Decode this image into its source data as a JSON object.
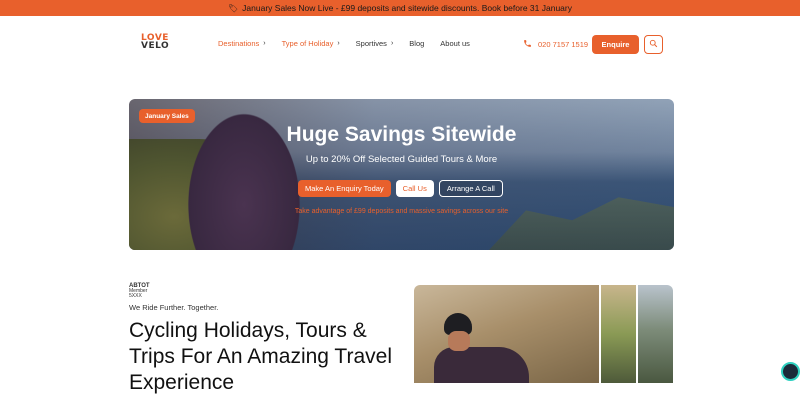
{
  "promo": {
    "icon": "tag-icon",
    "text": "January Sales Now Live - £99 deposits and sitewide discounts. Book before 31 January"
  },
  "logo": {
    "line1": "LOVE",
    "line2": "VELO"
  },
  "nav": {
    "items": [
      {
        "label": "Destinations",
        "has_chevron": true,
        "active": true
      },
      {
        "label": "Type of Holiday",
        "has_chevron": true,
        "active": true
      },
      {
        "label": "Sportives",
        "has_chevron": true,
        "active": false
      },
      {
        "label": "Blog",
        "has_chevron": false,
        "active": false
      },
      {
        "label": "About us",
        "has_chevron": false,
        "active": false
      }
    ],
    "chevron": "›"
  },
  "contact": {
    "phone": "020 7157 1519",
    "icon": "phone-icon"
  },
  "header": {
    "enquire_label": "Enquire",
    "search_icon": "search-icon"
  },
  "hero": {
    "badge": "January Sales",
    "title": "Huge Savings Sitewide",
    "subtitle": "Up to 20% Off Selected Guided Tours & More",
    "buttons": {
      "enquiry": "Make An Enquiry Today",
      "call": "Call Us",
      "arrange": "Arrange A Call"
    },
    "note": "Take advantage of £99 deposits and massive savings across our site"
  },
  "abtot": {
    "title": "ABTOT",
    "sub1": "Member",
    "sub2": "5XXX"
  },
  "intro": {
    "tagline": "We Ride Further. Together.",
    "headline": "Cycling Holidays, Tours & Trips For An Amazing Travel Experience"
  },
  "colors": {
    "accent": "#e8602c",
    "text": "#222222"
  }
}
